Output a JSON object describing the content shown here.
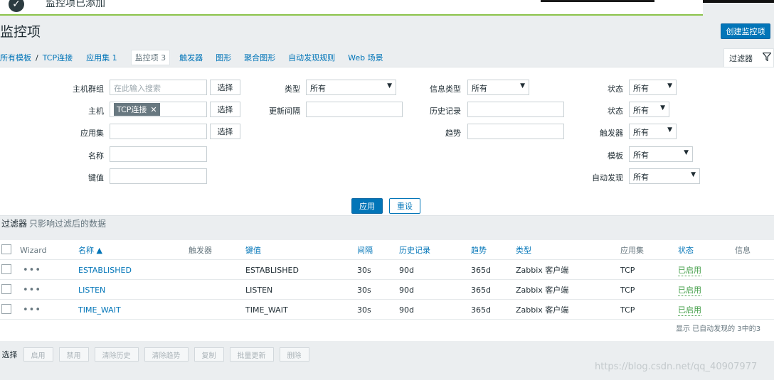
{
  "notice": {
    "icon": "check-icon",
    "message": "监控项已添加"
  },
  "header": {
    "title": "监控项",
    "create_button": "创建监控项"
  },
  "nav": {
    "breadcrumb_all_hosts": "所有模板",
    "separator": "/",
    "breadcrumb_host": "TCP连接",
    "tabs": [
      {
        "label": "应用集 1",
        "active": false
      },
      {
        "label": "监控项 3",
        "active": true
      },
      {
        "label": "触发器",
        "active": false
      },
      {
        "label": "图形",
        "active": false
      },
      {
        "label": "聚合图形",
        "active": false
      },
      {
        "label": "自动发现规则",
        "active": false
      },
      {
        "label": "Web 场景",
        "active": false
      }
    ],
    "filter_tab": "过滤器",
    "filter_icon": "funnel-icon"
  },
  "filter": {
    "host_group_label": "主机群组",
    "host_group_placeholder": "在此输入搜索",
    "host_label": "主机",
    "host_chip": "TCP连接",
    "application_label": "应用集",
    "name_label": "名称",
    "key_label": "键值",
    "select_button": "选择",
    "type_label": "类型",
    "type_value": "所有",
    "update_interval_label": "更新间隔",
    "info_type_label": "信息类型",
    "info_type_value": "所有",
    "history_label": "历史记录",
    "trends_label": "趋势",
    "state_label": "状态",
    "state_value": "所有",
    "status_label": "状态",
    "status_value": "所有",
    "triggers_label": "触发器",
    "triggers_value": "所有",
    "template_label": "模板",
    "template_value": "所有",
    "discovered_label": "自动发现",
    "discovered_value": "所有",
    "apply_button": "应用",
    "reset_button": "重设"
  },
  "subfilter": {
    "title": "过滤器",
    "hint": "只影响过滤后的数据"
  },
  "table": {
    "columns": {
      "wizard": "Wizard",
      "name": "名称 ▲",
      "triggers": "触发器",
      "key": "键值",
      "interval": "间隔",
      "history": "历史记录",
      "trends": "趋势",
      "type": "类型",
      "applications": "应用集",
      "status": "状态",
      "info": "信息"
    },
    "rows": [
      {
        "wizard": "•••",
        "name": "ESTABLISHED",
        "key": "ESTABLISHED",
        "interval": "30s",
        "history": "90d",
        "trends": "365d",
        "type": "Zabbix 客户端",
        "applications": "TCP",
        "status": "已启用"
      },
      {
        "wizard": "•••",
        "name": "LISTEN",
        "key": "LISTEN",
        "interval": "30s",
        "history": "90d",
        "trends": "365d",
        "type": "Zabbix 客户端",
        "applications": "TCP",
        "status": "已启用"
      },
      {
        "wizard": "•••",
        "name": "TIME_WAIT",
        "key": "TIME_WAIT",
        "interval": "30s",
        "history": "90d",
        "trends": "365d",
        "type": "Zabbix 客户端",
        "applications": "TCP",
        "status": "已启用"
      }
    ],
    "summary": "显示 已自动发现的 3中的3"
  },
  "actions": {
    "selected_label": "0 选择",
    "buttons": [
      "启用",
      "禁用",
      "清除历史",
      "清除趋势",
      "复制",
      "批量更新",
      "删除"
    ]
  },
  "watermark": "https://blog.csdn.net/qq_40907977",
  "colors": {
    "accent": "#0275b8",
    "enabled": "#429e47",
    "notice_border": "#8bc34a"
  }
}
